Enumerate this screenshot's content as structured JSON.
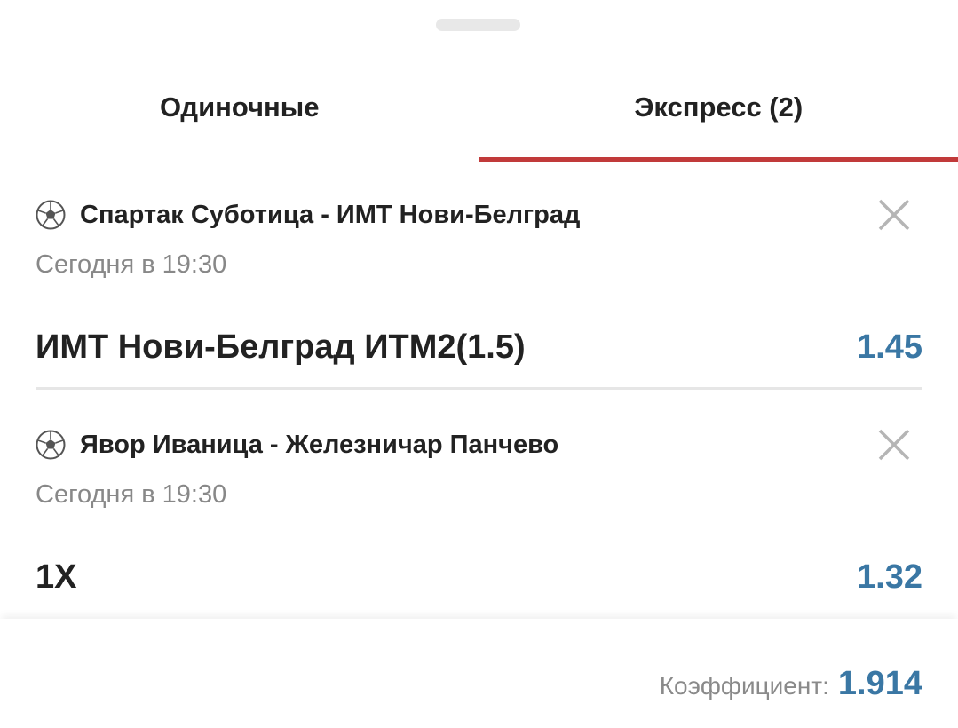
{
  "tabs": [
    {
      "label": "Одиночные",
      "active": false
    },
    {
      "label": "Экспресс (2)",
      "active": true
    }
  ],
  "events": [
    {
      "sport_icon": "soccer-ball-icon",
      "title": "Спартак Суботица - ИМТ Нови-Белград",
      "time": "Сегодня в 19:30",
      "bet": "ИМТ Нови-Белград ИТМ2(1.5)",
      "odds": "1.45"
    },
    {
      "sport_icon": "soccer-ball-icon",
      "title": "Явор Иваница - Железничар Панчево",
      "time": "Сегодня в 19:30",
      "bet": "1X",
      "odds": "1.32"
    }
  ],
  "footer": {
    "coef_label": "Коэффициент:",
    "coef_value": "1.914"
  },
  "colors": {
    "accent_red": "#c13a3a",
    "odds_blue": "#3a77a4"
  }
}
